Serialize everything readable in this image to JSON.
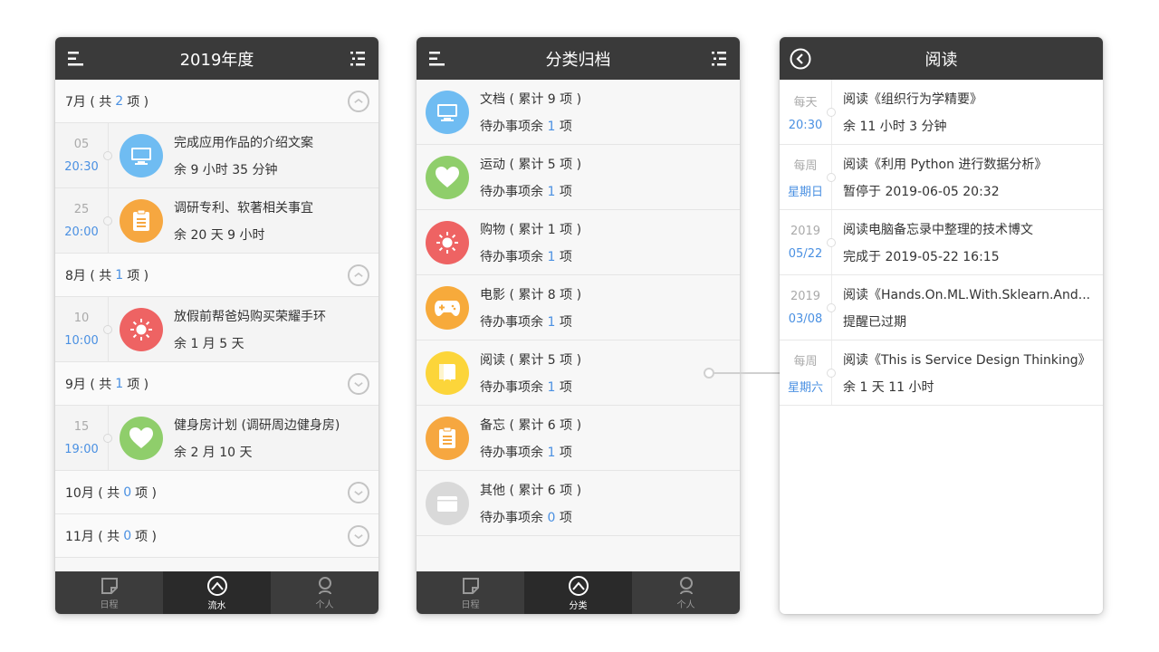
{
  "phone1": {
    "title": "2019年度",
    "groups": [
      {
        "month": "7月 ( 共",
        "count": "2",
        "suffix": "项 )",
        "items": [
          {
            "d1": "05",
            "d2": "20:30",
            "title": "完成应用作品的介绍文案",
            "sub": "余 9 小时 35 分钟"
          },
          {
            "d1": "25",
            "d2": "20:00",
            "title": "调研专利、软著相关事宜",
            "sub": "余 20 天 9 小时"
          }
        ]
      },
      {
        "month": "8月 ( 共",
        "count": "1",
        "suffix": "项 )",
        "items": [
          {
            "d1": "10",
            "d2": "10:00",
            "title": "放假前帮爸妈购买荣耀手环",
            "sub": "余 1 月 5 天"
          }
        ]
      },
      {
        "month": "9月 ( 共",
        "count": "1",
        "suffix": "项 )",
        "items": [
          {
            "d1": "15",
            "d2": "19:00",
            "title": "健身房计划 (调研周边健身房)",
            "sub": "余 2 月 10 天"
          }
        ]
      },
      {
        "month": "10月 ( 共",
        "count": "0",
        "suffix": "项 )"
      },
      {
        "month": "11月 ( 共",
        "count": "0",
        "suffix": "项 )"
      }
    ],
    "tabs": [
      "日程",
      "流水",
      "个人"
    ]
  },
  "phone2": {
    "title": "分类归档",
    "pending_label": "待办事项余",
    "unit": "项",
    "categories": [
      {
        "name": "文档 ( 累计 9 项 )",
        "left": "1"
      },
      {
        "name": "运动 ( 累计 5 项 )",
        "left": "1"
      },
      {
        "name": "购物 ( 累计 1 项 )",
        "left": "1"
      },
      {
        "name": "电影 ( 累计 8 项 )",
        "left": "1"
      },
      {
        "name": "阅读 ( 累计 5 项 )",
        "left": "1"
      },
      {
        "name": "备忘 ( 累计 6 项 )",
        "left": "1"
      },
      {
        "name": "其他 ( 累计 6 项 )",
        "left": "0"
      }
    ],
    "tabs": [
      "日程",
      "分类",
      "个人"
    ]
  },
  "phone3": {
    "title": "阅读",
    "items": [
      {
        "d1": "每天",
        "d2": "20:30",
        "title": "阅读《组织行为学精要》",
        "sub": "余 11 小时 3 分钟"
      },
      {
        "d1": "每周",
        "d2": "星期日",
        "title": "阅读《利用 Python 进行数据分析》",
        "sub": "暂停于  2019-06-05 20:32"
      },
      {
        "d1": "2019",
        "d2": "05/22",
        "title": "阅读电脑备忘录中整理的技术博文",
        "sub": "完成于 2019-05-22 16:15"
      },
      {
        "d1": "2019",
        "d2": "03/08",
        "title": "阅读《Hands.On.ML.With.Sklearn.And...",
        "sub": "提醒已过期"
      },
      {
        "d1": "每周",
        "d2": "星期六",
        "title": "阅读《This is Service Design Thinking》",
        "sub": "余 1 天 11 小时"
      }
    ]
  },
  "colors": {
    "header": "#3a3a3a",
    "accent": "#4a90e2",
    "doc": "#6fbcf2",
    "sport": "#8fce6b",
    "shop": "#ee6363",
    "movie": "#f7aa3b",
    "read": "#fcd53a",
    "memo": "#f6a740",
    "other": "#d9d9d9"
  }
}
